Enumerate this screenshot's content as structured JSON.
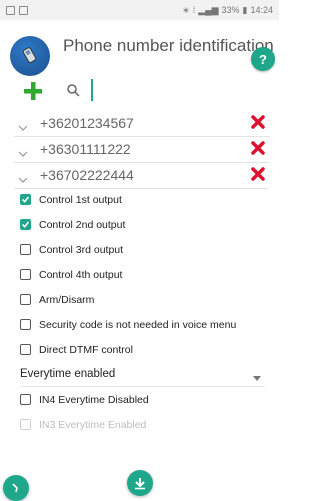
{
  "status_bar": {
    "battery": "33%",
    "time": "14:24"
  },
  "header": {
    "title": "Phone number identification",
    "help_label": "?"
  },
  "search": {
    "placeholder": "",
    "value": ""
  },
  "phones": [
    {
      "number": "+36201234567"
    },
    {
      "number": "+36301111222"
    },
    {
      "number": "+36702222444"
    }
  ],
  "options": [
    {
      "label": "Control 1st output",
      "checked": true
    },
    {
      "label": "Control 2nd output",
      "checked": true
    },
    {
      "label": "Control 3rd output",
      "checked": false
    },
    {
      "label": "Control 4th output",
      "checked": false
    },
    {
      "label": "Arm/Disarm",
      "checked": false
    },
    {
      "label": "Security code is not needed in voice menu",
      "checked": false
    },
    {
      "label": "Direct DTMF control",
      "checked": false
    }
  ],
  "everytime_select": {
    "selected": "Everytime enabled"
  },
  "extra_options": [
    {
      "label": "IN4 Everytime Disabled",
      "checked": false,
      "disabled": false
    },
    {
      "label": "IN3 Everytime Enabled",
      "checked": false,
      "disabled": true
    }
  ],
  "colors": {
    "accent": "#1fa78b",
    "delete": "#e0102f",
    "add": "#2eaa2e"
  }
}
